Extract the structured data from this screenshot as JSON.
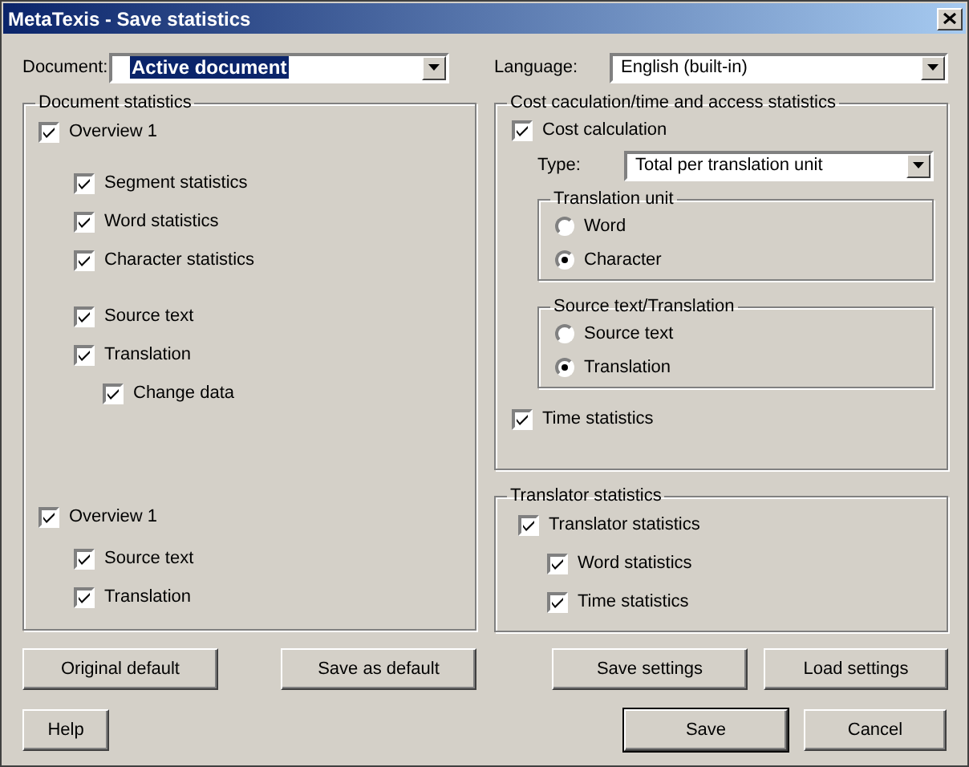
{
  "window": {
    "title": "MetaTexis - Save statistics"
  },
  "document": {
    "label": "Document:",
    "value": "Active document",
    "text_selected": true
  },
  "language": {
    "label": "Language:",
    "value": "English (built-in)",
    "text_selected": false
  },
  "document_statistics": {
    "title": "Document statistics",
    "overviews": [
      {
        "label": "Overview 1",
        "checked": true,
        "groups": [
          {
            "items": [
              {
                "label": "Segment statistics",
                "checked": true
              },
              {
                "label": "Word statistics",
                "checked": true
              },
              {
                "label": "Character statistics",
                "checked": true
              }
            ]
          },
          {
            "items": [
              {
                "label": "Source text",
                "checked": true
              },
              {
                "label": "Translation",
                "checked": true,
                "children": [
                  {
                    "label": "Change data",
                    "checked": true
                  }
                ]
              }
            ]
          }
        ]
      },
      {
        "label": "Overview 1",
        "checked": true,
        "groups": [
          {
            "items": [
              {
                "label": "Source text",
                "checked": true
              },
              {
                "label": "Translation",
                "checked": true
              }
            ]
          }
        ]
      }
    ]
  },
  "cost_statistics": {
    "title": "Cost caculation/time and access statistics",
    "cost_calculation": {
      "label": "Cost calculation",
      "checked": true
    },
    "type": {
      "label": "Type:",
      "value": "Total per translation unit"
    },
    "radio_groups": [
      {
        "title": "Translation unit",
        "options": [
          {
            "label": "Word",
            "selected": false
          },
          {
            "label": "Character",
            "selected": true
          }
        ]
      },
      {
        "title": "Source text/Translation",
        "options": [
          {
            "label": "Source text",
            "selected": false
          },
          {
            "label": "Translation",
            "selected": true
          }
        ]
      }
    ],
    "time_statistics": {
      "label": "Time statistics",
      "checked": true
    }
  },
  "translator_statistics": {
    "title": "Translator statistics",
    "items": [
      {
        "label": "Translator statistics",
        "checked": true,
        "children": [
          {
            "label": "Word statistics",
            "checked": true
          },
          {
            "label": "Time statistics",
            "checked": true
          }
        ]
      }
    ]
  },
  "buttons": [
    {
      "label": "Original default"
    },
    {
      "label": "Save as default"
    },
    {
      "label": "Save settings"
    },
    {
      "label": "Load settings"
    }
  ],
  "dialog_buttons": [
    {
      "label": "Help",
      "default": false
    },
    {
      "label": "Save",
      "default": true
    },
    {
      "label": "Cancel",
      "default": false
    }
  ]
}
